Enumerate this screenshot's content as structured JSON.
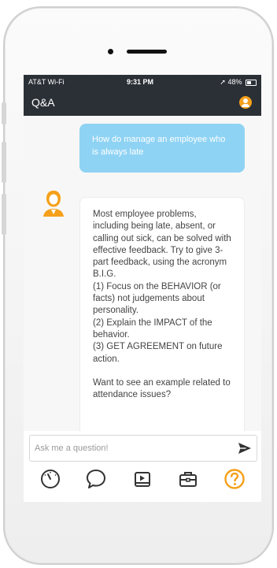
{
  "status_bar": {
    "carrier": "AT&T Wi-Fi",
    "time": "9:31 PM",
    "battery": "48%"
  },
  "header": {
    "title": "Q&A",
    "avatar_icon": "user-avatar-icon"
  },
  "chat": {
    "user_message": "How do manage an employee who is always late",
    "bot_message": "Most employee problems, including being late, absent, or calling out sick, can be solved with effective feedback. Try to give 3-part feedback, using the acronym B.I.G.\n(1) Focus on the BEHAVIOR (or facts) not judgements about personality.\n(2) Explain the IMPACT of the behavior.\n(3) GET AGREEMENT on future action.\n\nWant to see an example related to attendance issues?"
  },
  "input": {
    "placeholder": "Ask me a question!"
  },
  "tabs": [
    {
      "icon": "gauge-icon"
    },
    {
      "icon": "chat-bubble-icon"
    },
    {
      "icon": "video-play-icon"
    },
    {
      "icon": "toolbox-icon"
    },
    {
      "icon": "question-icon"
    }
  ],
  "colors": {
    "header_bg": "#2b3037",
    "accent_orange": "#f5a01a",
    "user_bubble": "#8fd3f4"
  }
}
